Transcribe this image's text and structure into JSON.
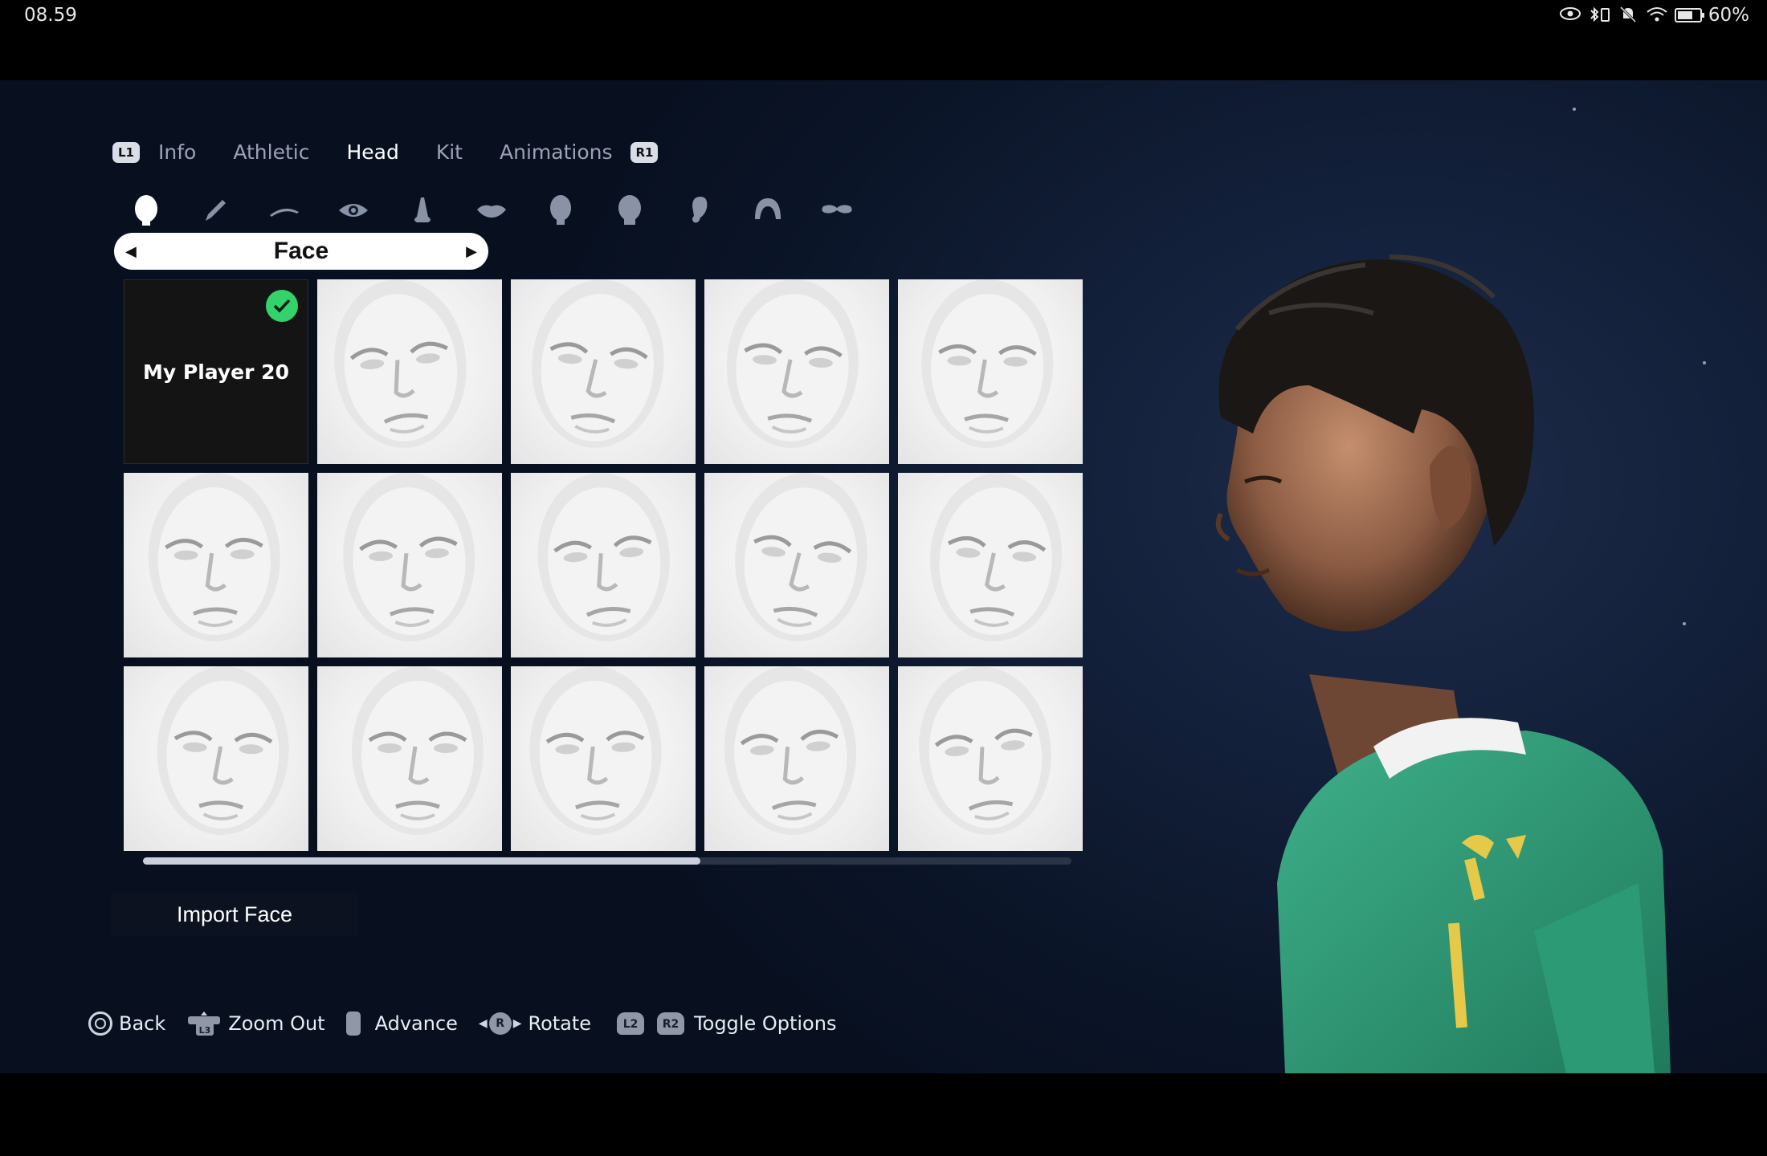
{
  "status_bar": {
    "time": "08.59",
    "battery": "60%",
    "battery_level": 0.6
  },
  "tabs": {
    "left_badge": "L1",
    "right_badge": "R1",
    "items": [
      {
        "label": "Info",
        "active": false
      },
      {
        "label": "Athletic",
        "active": false
      },
      {
        "label": "Head",
        "active": true
      },
      {
        "label": "Kit",
        "active": false
      },
      {
        "label": "Animations",
        "active": false
      }
    ]
  },
  "category_icons": [
    "head-shape-icon",
    "skin-brush-icon",
    "eyebrow-icon",
    "eye-icon",
    "nose-icon",
    "lips-icon",
    "head-front-icon",
    "head-back-icon",
    "ear-icon",
    "hair-icon",
    "moustache-icon"
  ],
  "selector": {
    "label": "Face"
  },
  "grid": {
    "selected": {
      "name": "My Player 20"
    },
    "face_count": 14
  },
  "scroll": {
    "thumb_fraction": 0.6
  },
  "import_button": "Import Face",
  "controls": {
    "back": "Back",
    "zoom_out": "Zoom Out",
    "zoom_badge": "L3",
    "advance": "Advance",
    "rotate": "Rotate",
    "rotate_badge": "R",
    "l2": "L2",
    "r2": "R2",
    "toggle_options": "Toggle Options"
  },
  "colors": {
    "check": "#31d36a",
    "jersey": "#2e9b78",
    "sponsor": "#e7c94a"
  }
}
